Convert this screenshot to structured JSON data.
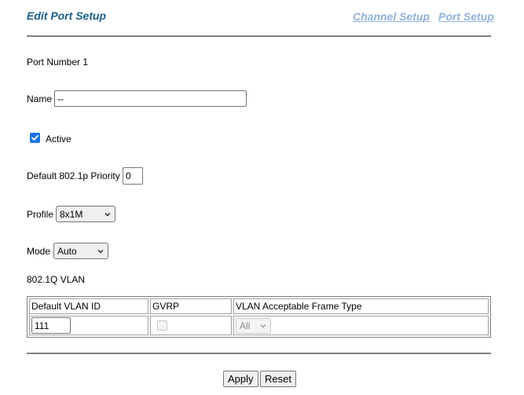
{
  "header": {
    "title": "Edit Port Setup",
    "links": [
      "Channel Setup",
      "Port Setup"
    ]
  },
  "form": {
    "port_number": "Port Number 1",
    "name_label": "Name",
    "name_value": "--",
    "active_label": "Active",
    "active_checked": true,
    "priority_label": "Default 802.1p Priority",
    "priority_value": "0",
    "profile_label": "Profile",
    "profile_value": "8x1M",
    "mode_label": "Mode",
    "mode_value": "Auto",
    "vlan_title": "802.1Q VLAN"
  },
  "vlan_table": {
    "headers": [
      "Default VLAN ID",
      "GVRP",
      "VLAN Acceptable Frame Type"
    ],
    "default_vlan_id": "111",
    "gvrp_checked": false,
    "frame_type": "All"
  },
  "buttons": {
    "apply": "Apply",
    "reset": "Reset"
  },
  "colors": {
    "title": "#1b5e8a",
    "link": "#8fb3dc",
    "checkbox": "#1a73e8"
  }
}
